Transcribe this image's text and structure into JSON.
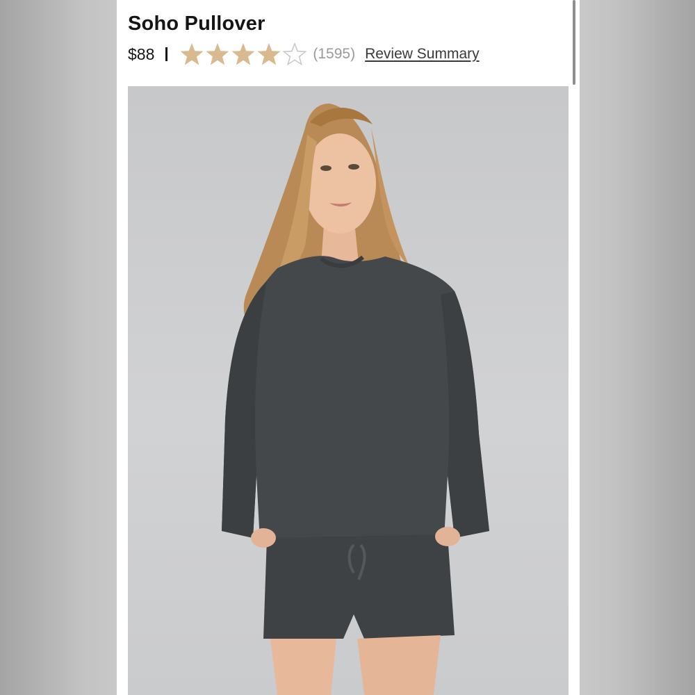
{
  "product": {
    "title": "Soho Pullover",
    "price": "$88",
    "rating": 4,
    "rating_max": 5,
    "review_count": "(1595)",
    "review_link": "Review Summary"
  },
  "colors": {
    "star_filled": "#d9b98f",
    "star_empty": "#cfcfcf",
    "garment": "#45484b",
    "background": "#cfd0d2"
  },
  "image": {
    "alt": "Model wearing dark grey Soho Pullover and matching shorts"
  }
}
